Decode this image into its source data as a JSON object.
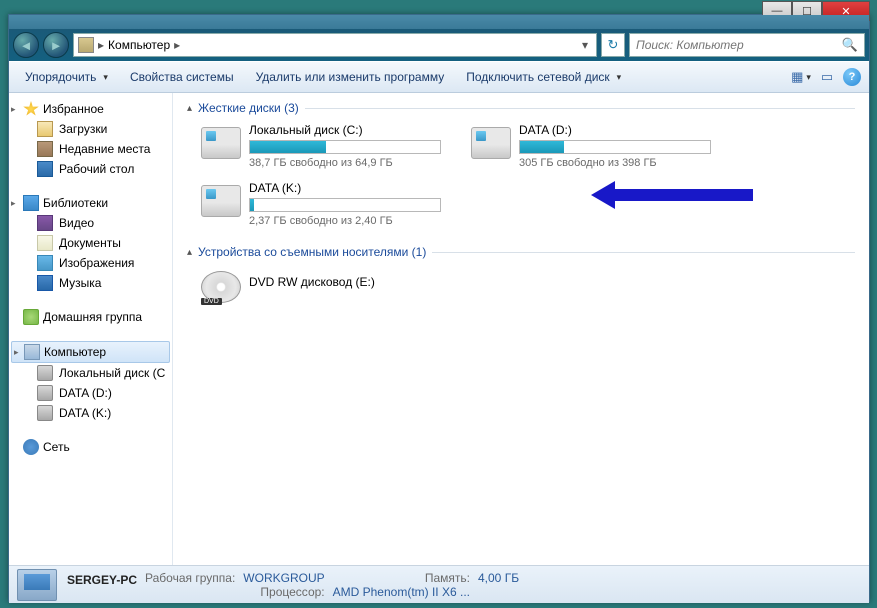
{
  "breadcrumb": {
    "label": "Компьютер",
    "chev": "▸"
  },
  "search": {
    "placeholder": "Поиск: Компьютер"
  },
  "toolbar": {
    "organize": "Упорядочить",
    "props": "Свойства системы",
    "uninstall": "Удалить или изменить программу",
    "netdrive": "Подключить сетевой диск"
  },
  "sidebar": {
    "favorites": {
      "label": "Избранное",
      "items": [
        "Загрузки",
        "Недавние места",
        "Рабочий стол"
      ]
    },
    "libraries": {
      "label": "Библиотеки",
      "items": [
        "Видео",
        "Документы",
        "Изображения",
        "Музыка"
      ]
    },
    "homegroup": {
      "label": "Домашняя группа"
    },
    "computer": {
      "label": "Компьютер",
      "items": [
        "Локальный диск (C",
        "DATA (D:)",
        "DATA (K:)"
      ]
    },
    "network": {
      "label": "Сеть"
    }
  },
  "groups": {
    "hdd": {
      "title": "Жесткие диски (3)"
    },
    "removable": {
      "title": "Устройства со съемными носителями (1)"
    }
  },
  "drives": [
    {
      "name": "Локальный диск (C:)",
      "free": "38,7 ГБ свободно из 64,9 ГБ",
      "fill": 40
    },
    {
      "name": "DATA (D:)",
      "free": "305 ГБ свободно из 398 ГБ",
      "fill": 23
    },
    {
      "name": "DATA (K:)",
      "free": "2,37 ГБ свободно из 2,40 ГБ",
      "fill": 2
    }
  ],
  "dvd": {
    "name": "DVD RW дисковод (E:)"
  },
  "status": {
    "name": "SERGEY-PC",
    "wg_label": "Рабочая группа:",
    "wg": "WORKGROUP",
    "mem_label": "Память:",
    "mem": "4,00 ГБ",
    "cpu_label": "Процессор:",
    "cpu": "AMD Phenom(tm) II X6 ..."
  }
}
